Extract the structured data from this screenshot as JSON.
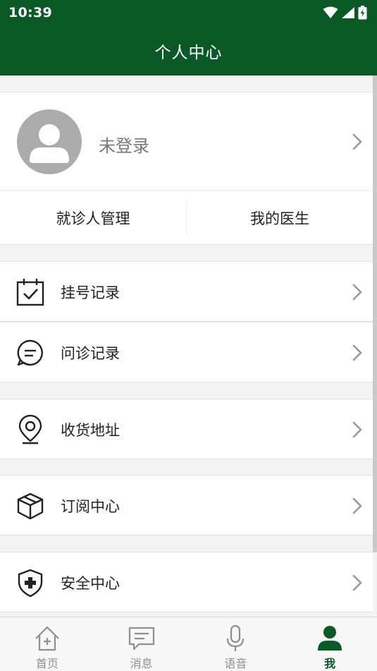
{
  "status_bar": {
    "time": "10:39"
  },
  "header": {
    "title": "个人中心"
  },
  "profile": {
    "login_text": "未登录"
  },
  "quick_actions": [
    {
      "label": "就诊人管理"
    },
    {
      "label": "我的医生"
    }
  ],
  "menu": [
    {
      "label": "挂号记录",
      "icon": "calendar-check-icon"
    },
    {
      "label": "问诊记录",
      "icon": "chat-bubble-icon"
    },
    {
      "label": "收货地址",
      "icon": "location-pin-icon"
    },
    {
      "label": "订阅中心",
      "icon": "box-icon"
    },
    {
      "label": "安全中心",
      "icon": "shield-plus-icon"
    }
  ],
  "tabs": [
    {
      "label": "首页",
      "icon": "home-icon",
      "active": false
    },
    {
      "label": "消息",
      "icon": "message-icon",
      "active": false
    },
    {
      "label": "语音",
      "icon": "microphone-icon",
      "active": false
    },
    {
      "label": "我",
      "icon": "person-icon",
      "active": true
    }
  ],
  "colors": {
    "brand": "#0b5a26",
    "tab_inactive": "#8f8f8f",
    "chevron": "#9a9a9a",
    "avatar_bg": "#ababab"
  }
}
